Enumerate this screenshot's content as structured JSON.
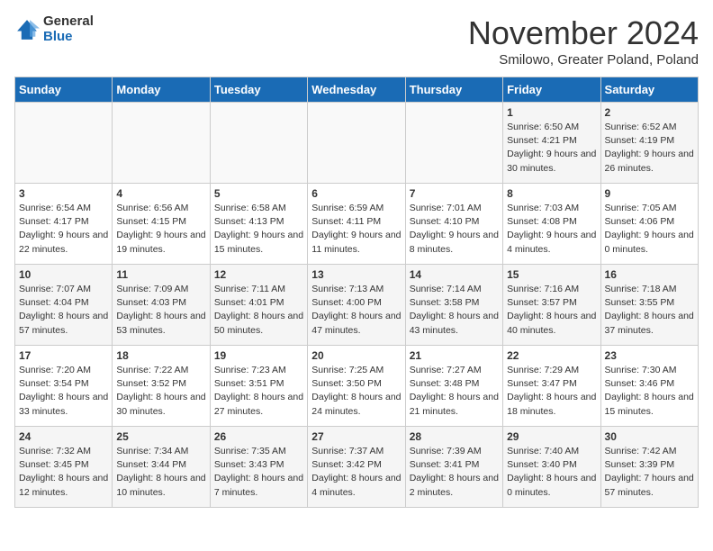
{
  "header": {
    "logo_general": "General",
    "logo_blue": "Blue",
    "month_title": "November 2024",
    "location": "Smilowo, Greater Poland, Poland"
  },
  "weekdays": [
    "Sunday",
    "Monday",
    "Tuesday",
    "Wednesday",
    "Thursday",
    "Friday",
    "Saturday"
  ],
  "weeks": [
    [
      {
        "day": "",
        "info": ""
      },
      {
        "day": "",
        "info": ""
      },
      {
        "day": "",
        "info": ""
      },
      {
        "day": "",
        "info": ""
      },
      {
        "day": "",
        "info": ""
      },
      {
        "day": "1",
        "info": "Sunrise: 6:50 AM\nSunset: 4:21 PM\nDaylight: 9 hours and 30 minutes."
      },
      {
        "day": "2",
        "info": "Sunrise: 6:52 AM\nSunset: 4:19 PM\nDaylight: 9 hours and 26 minutes."
      }
    ],
    [
      {
        "day": "3",
        "info": "Sunrise: 6:54 AM\nSunset: 4:17 PM\nDaylight: 9 hours and 22 minutes."
      },
      {
        "day": "4",
        "info": "Sunrise: 6:56 AM\nSunset: 4:15 PM\nDaylight: 9 hours and 19 minutes."
      },
      {
        "day": "5",
        "info": "Sunrise: 6:58 AM\nSunset: 4:13 PM\nDaylight: 9 hours and 15 minutes."
      },
      {
        "day": "6",
        "info": "Sunrise: 6:59 AM\nSunset: 4:11 PM\nDaylight: 9 hours and 11 minutes."
      },
      {
        "day": "7",
        "info": "Sunrise: 7:01 AM\nSunset: 4:10 PM\nDaylight: 9 hours and 8 minutes."
      },
      {
        "day": "8",
        "info": "Sunrise: 7:03 AM\nSunset: 4:08 PM\nDaylight: 9 hours and 4 minutes."
      },
      {
        "day": "9",
        "info": "Sunrise: 7:05 AM\nSunset: 4:06 PM\nDaylight: 9 hours and 0 minutes."
      }
    ],
    [
      {
        "day": "10",
        "info": "Sunrise: 7:07 AM\nSunset: 4:04 PM\nDaylight: 8 hours and 57 minutes."
      },
      {
        "day": "11",
        "info": "Sunrise: 7:09 AM\nSunset: 4:03 PM\nDaylight: 8 hours and 53 minutes."
      },
      {
        "day": "12",
        "info": "Sunrise: 7:11 AM\nSunset: 4:01 PM\nDaylight: 8 hours and 50 minutes."
      },
      {
        "day": "13",
        "info": "Sunrise: 7:13 AM\nSunset: 4:00 PM\nDaylight: 8 hours and 47 minutes."
      },
      {
        "day": "14",
        "info": "Sunrise: 7:14 AM\nSunset: 3:58 PM\nDaylight: 8 hours and 43 minutes."
      },
      {
        "day": "15",
        "info": "Sunrise: 7:16 AM\nSunset: 3:57 PM\nDaylight: 8 hours and 40 minutes."
      },
      {
        "day": "16",
        "info": "Sunrise: 7:18 AM\nSunset: 3:55 PM\nDaylight: 8 hours and 37 minutes."
      }
    ],
    [
      {
        "day": "17",
        "info": "Sunrise: 7:20 AM\nSunset: 3:54 PM\nDaylight: 8 hours and 33 minutes."
      },
      {
        "day": "18",
        "info": "Sunrise: 7:22 AM\nSunset: 3:52 PM\nDaylight: 8 hours and 30 minutes."
      },
      {
        "day": "19",
        "info": "Sunrise: 7:23 AM\nSunset: 3:51 PM\nDaylight: 8 hours and 27 minutes."
      },
      {
        "day": "20",
        "info": "Sunrise: 7:25 AM\nSunset: 3:50 PM\nDaylight: 8 hours and 24 minutes."
      },
      {
        "day": "21",
        "info": "Sunrise: 7:27 AM\nSunset: 3:48 PM\nDaylight: 8 hours and 21 minutes."
      },
      {
        "day": "22",
        "info": "Sunrise: 7:29 AM\nSunset: 3:47 PM\nDaylight: 8 hours and 18 minutes."
      },
      {
        "day": "23",
        "info": "Sunrise: 7:30 AM\nSunset: 3:46 PM\nDaylight: 8 hours and 15 minutes."
      }
    ],
    [
      {
        "day": "24",
        "info": "Sunrise: 7:32 AM\nSunset: 3:45 PM\nDaylight: 8 hours and 12 minutes."
      },
      {
        "day": "25",
        "info": "Sunrise: 7:34 AM\nSunset: 3:44 PM\nDaylight: 8 hours and 10 minutes."
      },
      {
        "day": "26",
        "info": "Sunrise: 7:35 AM\nSunset: 3:43 PM\nDaylight: 8 hours and 7 minutes."
      },
      {
        "day": "27",
        "info": "Sunrise: 7:37 AM\nSunset: 3:42 PM\nDaylight: 8 hours and 4 minutes."
      },
      {
        "day": "28",
        "info": "Sunrise: 7:39 AM\nSunset: 3:41 PM\nDaylight: 8 hours and 2 minutes."
      },
      {
        "day": "29",
        "info": "Sunrise: 7:40 AM\nSunset: 3:40 PM\nDaylight: 8 hours and 0 minutes."
      },
      {
        "day": "30",
        "info": "Sunrise: 7:42 AM\nSunset: 3:39 PM\nDaylight: 7 hours and 57 minutes."
      }
    ]
  ]
}
